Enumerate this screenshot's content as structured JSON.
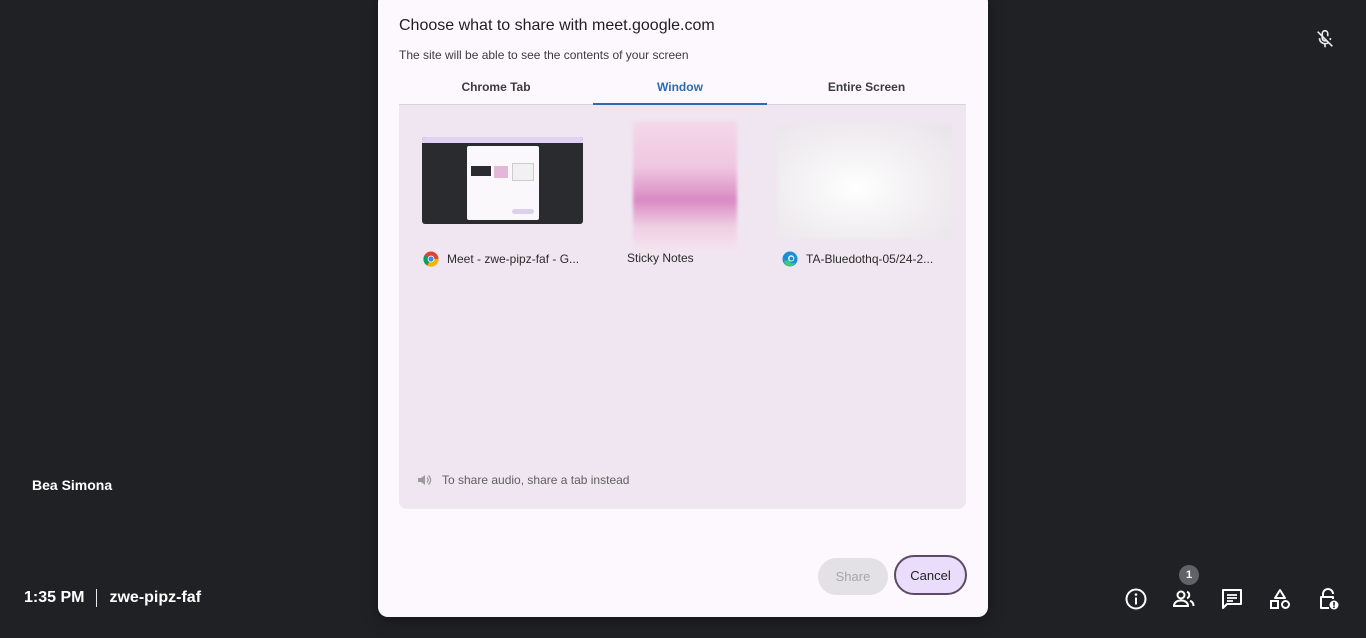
{
  "meeting": {
    "user_name": "Bea Simona",
    "time": "1:35 PM",
    "code": "zwe-pipz-faf",
    "participants_count": "1"
  },
  "dialog": {
    "title": "Choose what to share with meet.google.com",
    "subtitle": "The site will be able to see the contents of your screen",
    "tabs": [
      {
        "label": "Chrome Tab",
        "active": false
      },
      {
        "label": "Window",
        "active": true
      },
      {
        "label": "Entire Screen",
        "active": false
      }
    ],
    "sources": [
      {
        "label": "Meet - zwe-pipz-faf - G...",
        "app_icon": "chrome-icon"
      },
      {
        "label": "Sticky Notes",
        "app_icon": ""
      },
      {
        "label": "TA-Bluedothq-05/24-2...",
        "app_icon": "edge-icon"
      }
    ],
    "audio_note": "To share audio, share a tab instead",
    "share_label": "Share",
    "cancel_label": "Cancel"
  },
  "colors": {
    "background": "#202124",
    "dialog": "#fcf8fd",
    "panel": "#f0e6f1",
    "active_tab": "#2b6cb0",
    "cancel_bg": "#e9ddfb"
  }
}
